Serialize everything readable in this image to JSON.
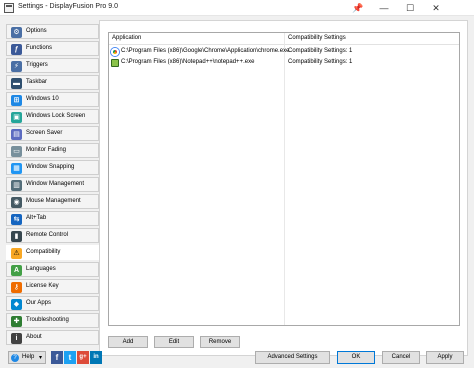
{
  "window": {
    "title": "Settings - DisplayFusion Pro 9.0",
    "minimize_glyph": "—",
    "maximize_glyph": "☐",
    "close_glyph": "✕",
    "pin_glyph": "📌"
  },
  "sidebar": {
    "items": [
      {
        "label": "Options",
        "icon": "gears-icon",
        "color": "#4a6fa5",
        "glyph": "⚙"
      },
      {
        "label": "Functions",
        "icon": "functions-icon",
        "color": "#3b5998",
        "glyph": "ƒ"
      },
      {
        "label": "Triggers",
        "icon": "triggers-icon",
        "color": "#4a6fa5",
        "glyph": "⚡"
      },
      {
        "label": "Taskbar",
        "icon": "taskbar-icon",
        "color": "#2f4f6f",
        "glyph": "▬"
      },
      {
        "label": "Windows 10",
        "icon": "windows-icon",
        "color": "#1e88e5",
        "glyph": "⊞"
      },
      {
        "label": "Windows Lock Screen",
        "icon": "lock-screen-icon",
        "color": "#26a69a",
        "glyph": "▣"
      },
      {
        "label": "Screen Saver",
        "icon": "screen-saver-icon",
        "color": "#5c6bc0",
        "glyph": "▤"
      },
      {
        "label": "Monitor Fading",
        "icon": "monitor-fading-icon",
        "color": "#78909c",
        "glyph": "▭"
      },
      {
        "label": "Window Snapping",
        "icon": "window-snapping-icon",
        "color": "#2196f3",
        "glyph": "▦"
      },
      {
        "label": "Window Management",
        "icon": "window-management-icon",
        "color": "#546e7a",
        "glyph": "▥"
      },
      {
        "label": "Mouse Management",
        "icon": "mouse-icon",
        "color": "#455a64",
        "glyph": "◉"
      },
      {
        "label": "Alt+Tab",
        "icon": "alt-tab-icon",
        "color": "#1565c0",
        "glyph": "⇆"
      },
      {
        "label": "Remote Control",
        "icon": "remote-control-icon",
        "color": "#37474f",
        "glyph": "▮"
      },
      {
        "label": "Compatibility",
        "icon": "compatibility-icon",
        "color": "#f9a825",
        "glyph": "⚠"
      },
      {
        "label": "Languages",
        "icon": "languages-icon",
        "color": "#43a047",
        "glyph": "A"
      },
      {
        "label": "License Key",
        "icon": "license-key-icon",
        "color": "#ef6c00",
        "glyph": "⚷"
      },
      {
        "label": "Our Apps",
        "icon": "our-apps-icon",
        "color": "#0288d1",
        "glyph": "◆"
      },
      {
        "label": "Troubleshooting",
        "icon": "troubleshooting-icon",
        "color": "#2e7d32",
        "glyph": "✚"
      },
      {
        "label": "About",
        "icon": "about-icon",
        "color": "#424242",
        "glyph": "i"
      }
    ],
    "active_index": 13
  },
  "compat_list": {
    "headers": {
      "application": "Application",
      "settings": "Compatibility Settings"
    },
    "rows": [
      {
        "application": "C:\\Program Files (x86)\\Google\\Chrome\\Application\\chrome.exe",
        "settings": "Compatibility Settings: 1",
        "icon": "chrome-icon"
      },
      {
        "application": "C:\\Program Files (x86)\\Notepad++\\notepad++.exe",
        "settings": "Compatibility Settings: 1",
        "icon": "notepad-plus-plus-icon"
      }
    ]
  },
  "list_buttons": {
    "add": "Add",
    "edit": "Edit",
    "remove": "Remove"
  },
  "footer": {
    "help": "Help",
    "help_chevron": "▾",
    "help_glyph": "?",
    "advanced_settings": "Advanced Settings",
    "ok": "OK",
    "cancel": "Cancel",
    "apply": "Apply",
    "social": [
      {
        "name": "facebook-icon",
        "glyph": "f",
        "color": "#3b5998"
      },
      {
        "name": "twitter-icon",
        "glyph": "t",
        "color": "#1da1f2"
      },
      {
        "name": "google-plus-icon",
        "glyph": "g+",
        "color": "#dd4b39"
      },
      {
        "name": "linkedin-icon",
        "glyph": "in",
        "color": "#0077b5"
      }
    ]
  }
}
